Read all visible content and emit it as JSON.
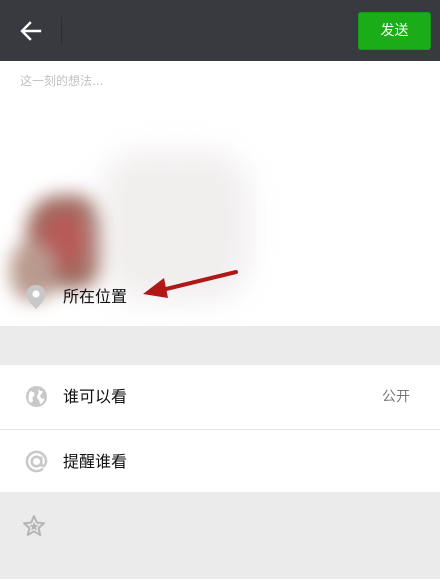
{
  "header": {
    "back_icon": "arrow-left-icon",
    "send_label": "发送"
  },
  "compose": {
    "placeholder": "这一刻的想法...",
    "value": ""
  },
  "location": {
    "icon": "location-pin-icon",
    "label": "所在位置"
  },
  "settings": {
    "items": [
      {
        "icon": "globe-icon",
        "label": "谁可以看",
        "value": "公开"
      },
      {
        "icon": "at-icon",
        "label": "提醒谁看",
        "value": ""
      }
    ]
  },
  "bottom": {
    "icon": "star-icon"
  },
  "colors": {
    "topbar": "#393a3f",
    "send_button": "#1aad19",
    "annotation_arrow": "#b01818",
    "icon_gray": "#c8c8c8",
    "section_gap": "#ebebeb"
  }
}
